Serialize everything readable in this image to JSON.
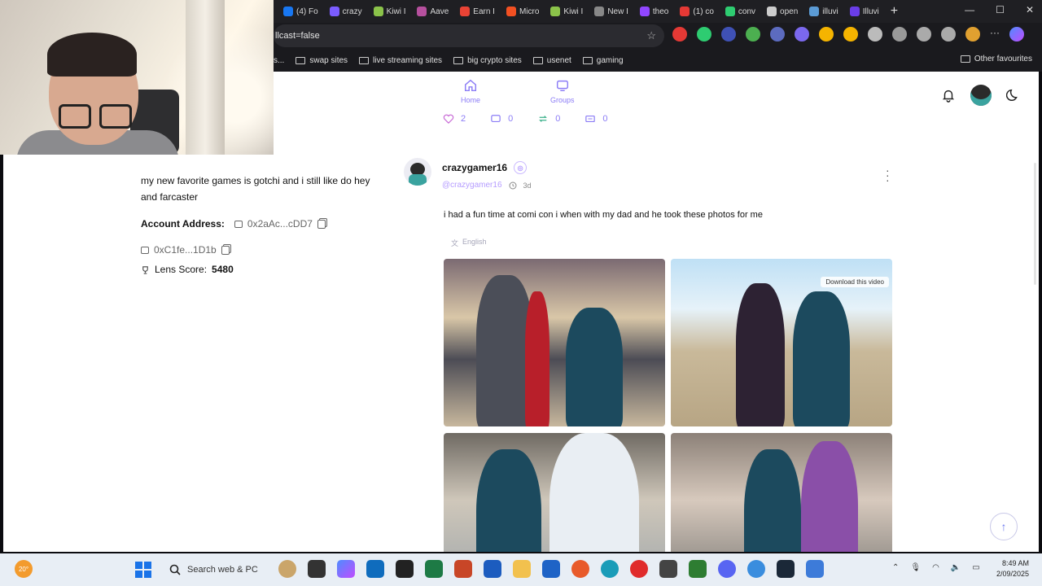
{
  "browser": {
    "tabs": [
      {
        "label": "(4) Fo",
        "color": "#1877f2"
      },
      {
        "label": "crazy",
        "color": "#7b5cff"
      },
      {
        "label": "Kiwi I",
        "color": "#8bc34a"
      },
      {
        "label": "Aave",
        "color": "#b6509e"
      },
      {
        "label": "Earn I",
        "color": "#ea4335"
      },
      {
        "label": "Micro",
        "color": "#f25022"
      },
      {
        "label": "Kiwi I",
        "color": "#8bc34a"
      },
      {
        "label": "New I",
        "color": "#888888"
      },
      {
        "label": "theo",
        "color": "#9146ff"
      },
      {
        "label": "(1) co",
        "color": "#e53935"
      },
      {
        "label": "conv",
        "color": "#2ecc71"
      },
      {
        "label": "open",
        "color": "#cccccc"
      },
      {
        "label": "illuvi",
        "color": "#5b9bd5"
      },
      {
        "label": "Illuvi",
        "color": "#6a3de8"
      }
    ],
    "new_tab": "+",
    "window_controls": {
      "minimize": "—",
      "maximize": "☐",
      "close": "✕"
    },
    "address": "llcast=false",
    "bookmarks": [
      {
        "label": "swap sites"
      },
      {
        "label": "live streaming sites"
      },
      {
        "label": "big crypto sites"
      },
      {
        "label": "usenet"
      },
      {
        "label": "gaming"
      }
    ],
    "bookmark_overflow": "s...",
    "other_favourites": "Other favourites"
  },
  "nav": {
    "home": "Home",
    "groups": "Groups"
  },
  "stats": {
    "likes": "2",
    "comments": "0",
    "reposts": "0",
    "quotes": "0"
  },
  "profile": {
    "bio": "my new favorite games is gotchi and i still like do hey and farcaster",
    "account_address_label": "Account Address:",
    "account_address": "0x2aAc...cDD7",
    "second_address": "0xC1fe...1D1b",
    "lens_score_label": "Lens Score:",
    "lens_score": "5480"
  },
  "post": {
    "username": "crazygamer16",
    "badge": "◎",
    "handle": "@crazygamer16",
    "time": "3d",
    "text": "i had a fun time at comi con i when with my dad and he took these photos for me",
    "language": "English",
    "download_chip": "Download this video"
  },
  "taskbar": {
    "weather": "20°",
    "search_placeholder": "Search web & PC",
    "time": "8:49 AM",
    "date": "2/09/2025"
  }
}
